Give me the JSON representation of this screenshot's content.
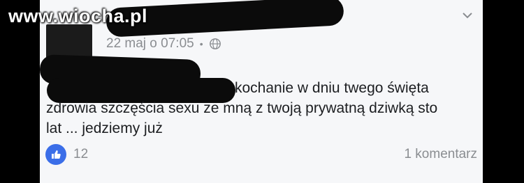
{
  "watermark": "www.wiocha.pl",
  "post": {
    "timestamp": "22 maj o 07:05",
    "separator": "•",
    "text_line1": "kochanie w dniu twego święta",
    "text_line2": "zdrowia szczęścia sexu ze mną z twoją prywatną dziwką sto",
    "text_line3": "lat ...  jedziemy już"
  },
  "footer": {
    "likes": "12",
    "comments": "1 komentarz"
  },
  "icons": {
    "privacy": "globe-icon",
    "menu": "chevron-down-icon",
    "reaction": "thumbs-up-icon"
  },
  "colors": {
    "accent": "#3b6ee8",
    "meta_text": "#8a8d91",
    "body_text": "#1c1e21",
    "card_bg": "#f6f7f9"
  }
}
